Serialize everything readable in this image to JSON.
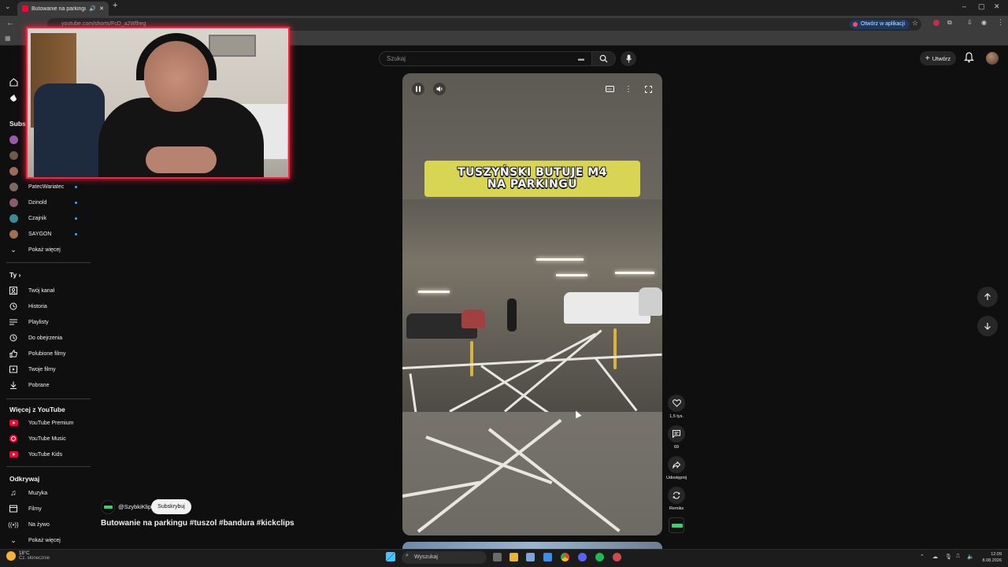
{
  "browser": {
    "tab_title": "Butowanie na parkingu #tu",
    "url": "youtube.com/shorts/FcD_a2Wlheg",
    "open_in_app": "Otwórz w aplikacji"
  },
  "header": {
    "search_placeholder": "Szukaj",
    "create_label": "Utwórz"
  },
  "sidebar": {
    "subscriptions_title": "Subsk",
    "subscriptions": [
      {
        "label": "PatecWariatec",
        "color": "#7a6a60"
      },
      {
        "label": "Dzinold",
        "color": "#8a5a70"
      },
      {
        "label": "Czajnik",
        "color": "#3a8a9a"
      },
      {
        "label": "SAYGON",
        "color": "#a07050"
      }
    ],
    "show_more": "Pokaż więcej",
    "you_title": "Ty",
    "you_items": [
      "Twój kanał",
      "Historia",
      "Playlisty",
      "Do obejrzenia",
      "Polubione filmy",
      "Twoje filmy",
      "Pobrane"
    ],
    "more_title": "Więcej z YouTube",
    "more_items": [
      "YouTube Premium",
      "YouTube Music",
      "YouTube Kids"
    ],
    "explore_title": "Odkrywaj",
    "explore_items": [
      "Muzyka",
      "Filmy",
      "Na żywo"
    ],
    "explore_more": "Pokaż więcej"
  },
  "short": {
    "caption_line1": "TUSZYŃSKI BUTUJE M4",
    "caption_line2": "NA PARKINGU",
    "likes": "1,5 tys.",
    "comments": "69",
    "share": "Udostępnij",
    "remix": "Remiks",
    "channel": "@SzybkiKlip",
    "subscribe": "Subskrybuj",
    "title": "Butowanie na parkingu #tuszol #bandura #kickclips"
  },
  "taskbar": {
    "temp": "18°C",
    "weather": "Cz. słonecznie",
    "search": "Wyszukaj",
    "time": "12:09",
    "date": "8.08.2026"
  },
  "colors": {
    "accent_red": "#ff1f3d",
    "caption_yellow": "#d8d454",
    "youtube_red": "#ff0033"
  }
}
